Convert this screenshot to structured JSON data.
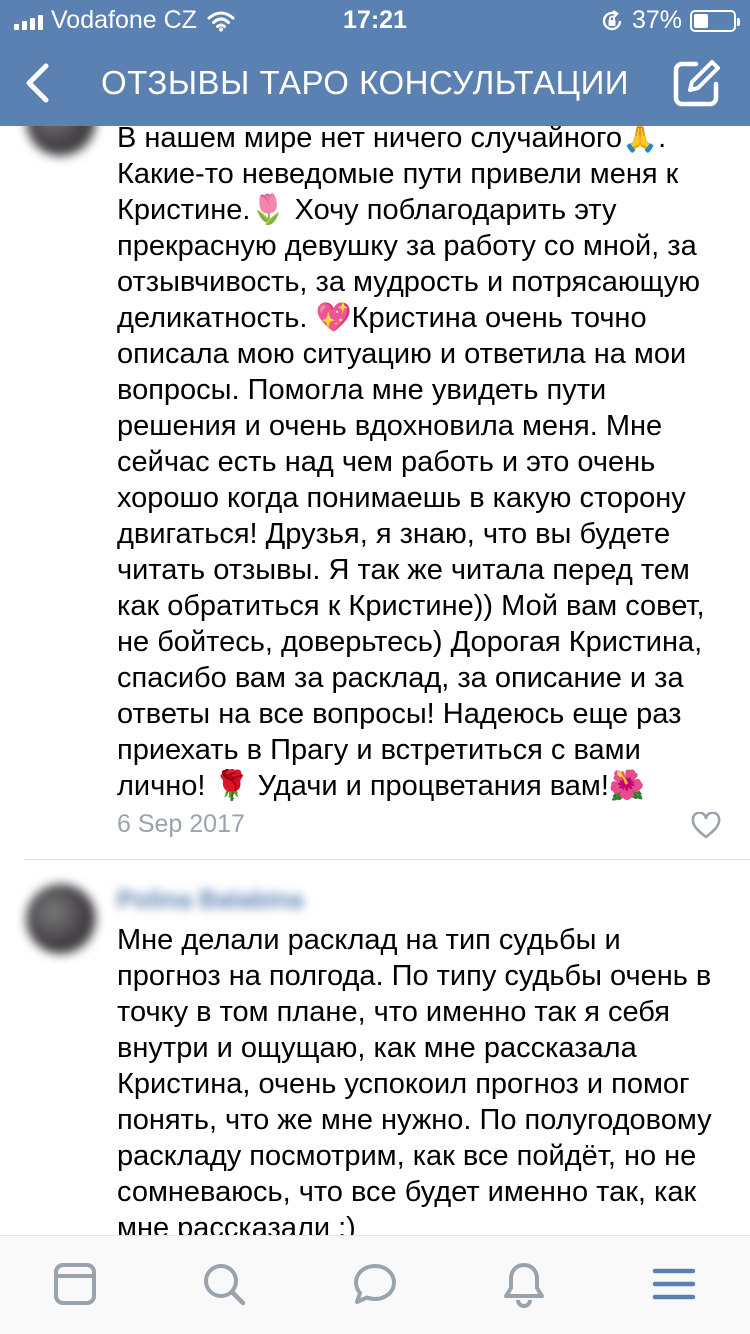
{
  "status_bar": {
    "carrier": "Vodafone CZ",
    "time": "17:21",
    "battery": "37%",
    "battery_level": 0.37
  },
  "header": {
    "title": "ОТЗЫВЫ ТАРО КОНСУЛЬТАЦИИ",
    "back_icon": "chevron-left-icon",
    "compose_icon": "compose-icon"
  },
  "comments": [
    {
      "text": "В нашем мире нет ничего случайного🙏. Какие-то неведомые пути привели меня к Кристине.🌷  Хочу поблагодарить эту прекрасную девушку за работу со мной, за отзывчивость, за мудрость и потрясающую деликатность. 💖Кристина очень точно описала мою ситуацию и ответила на мои вопросы. Помогла мне увидеть пути решения и очень вдохновила меня. Мне сейчас есть над чем работь и это очень хорошо когда понимаешь в какую сторону двигаться! Друзья, я знаю, что вы будете читать отзывы. Я так же читала перед тем как обратиться к Кристине)) Мой вам совет, не бойтесь, доверьтесь) Дорогая Кристина, спасибо вам за расклад, за описание и за ответы на все вопросы!   Надеюсь еще раз приехать в Прагу и встретиться с вами лично! 🌹 Удачи и процветания вам!🌺",
      "date": "6 Sep 2017"
    },
    {
      "author": "Polina Balabina",
      "text": "Мне делали расклад на тип судьбы и прогноз на полгода. По типу судьбы очень в точку в том плане, что именно так я себя внутри и ощущаю, как мне рассказала Кристина, очень успокоил прогноз и помог понять, что же мне нужно. По полугодовому раскладу посмотрим, как все пойдёт, но не сомневаюсь, что все будет именно так, как мне рассказали :)"
    }
  ],
  "tab_bar": {
    "items": [
      "feed-icon",
      "search-icon",
      "messages-icon",
      "notifications-icon",
      "menu-icon"
    ],
    "accent": "#5b80b2",
    "inactive": "#99a2ad"
  },
  "colors": {
    "header_bg": "#5b80b2",
    "date_text": "#9aa3ad"
  }
}
